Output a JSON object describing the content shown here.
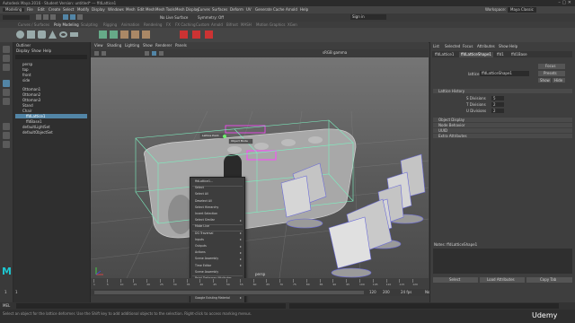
{
  "window": {
    "title": "Autodesk Maya 2016 - Student Version: untitled* --- ffdLattice1"
  },
  "menubar": {
    "mode": "Modeling",
    "items": [
      "File",
      "Edit",
      "Create",
      "Select",
      "Modify",
      "Display",
      "Windows",
      "Mesh",
      "Edit Mesh",
      "Mesh Tools",
      "Mesh Display",
      "Curves",
      "Surfaces",
      "Deform",
      "UV",
      "Generate",
      "Cache",
      "Arnold",
      "Help"
    ],
    "workspace": "Maya Classic",
    "signin": "Sign in"
  },
  "status": {
    "no_live_surface": "No Live Surface",
    "symmetry": "Symmetry: Off"
  },
  "shelf": {
    "tabs": [
      "Curves / Surfaces",
      "Poly Modeling",
      "Sculpting",
      "Rigging",
      "Animation",
      "Rendering",
      "FX",
      "FX Caching",
      "Custom",
      "Arnold",
      "Bifrost",
      "MASH",
      "Motion Graphics",
      "XGen"
    ]
  },
  "outliner": {
    "title": "Outliner",
    "menus": [
      "Display",
      "Show",
      "Help"
    ],
    "items": [
      "persp",
      "top",
      "front",
      "side",
      "Ottoman1",
      "Ottoman2",
      "Ottoman3",
      "Stand",
      "Chair",
      "ffdLattice1",
      "ffdBase1",
      "defaultLightSet",
      "defaultObjectSet"
    ],
    "selected_index": 9
  },
  "viewport": {
    "menus": [
      "View",
      "Shading",
      "Lighting",
      "Show",
      "Renderer",
      "Panels"
    ],
    "color_space": "sRGB gamma",
    "camera": "persp",
    "lattice_label": "Lattice Point",
    "object_mode_label": "Object Mode"
  },
  "context_menu": {
    "items": [
      {
        "label": "ffdLattice1...",
        "arrow": false
      },
      {
        "label": "Select",
        "arrow": false
      },
      {
        "label": "Select All",
        "arrow": false
      },
      {
        "label": "Deselect All",
        "arrow": false
      },
      {
        "label": "Select Hierarchy",
        "arrow": false
      },
      {
        "label": "Invert Selection",
        "arrow": false
      },
      {
        "label": "Select Similar",
        "arrow": true
      },
      {
        "label": "Make Live",
        "arrow": false
      },
      {
        "label": "DG Traversal",
        "arrow": true
      },
      {
        "label": "Inputs",
        "arrow": true
      },
      {
        "label": "Outputs",
        "arrow": true
      },
      {
        "label": "Actions",
        "arrow": true
      },
      {
        "label": "Scene Assembly",
        "arrow": true
      },
      {
        "label": "Time Editor",
        "arrow": true
      },
      {
        "label": "Scene Assembly",
        "arrow": false
      },
      {
        "label": "Paint Deformer Attributes...",
        "arrow": false
      },
      {
        "label": "Google Ramp Material",
        "arrow": true
      },
      {
        "label": "Google Transfer Material",
        "arrow": true
      },
      {
        "label": "Google Existing Material",
        "arrow": true
      },
      {
        "label": "Remove Material Override",
        "arrow": true
      }
    ]
  },
  "attribute_editor": {
    "menus": [
      "List",
      "Selected",
      "Focus",
      "Attributes",
      "Show",
      "Help"
    ],
    "tabs": [
      "ffdLattice1",
      "ffdLatticeShape1",
      "ffd1",
      "ffd1Base"
    ],
    "field_label": "lattice:",
    "field_value": "ffdLatticeShape1",
    "focus": "Focus",
    "presets": "Presets",
    "show_label": "Show",
    "hide_label": "Hide",
    "sections": [
      "Lattice History",
      "Object Display",
      "Node Behavior",
      "UUID",
      "Extra Attributes"
    ],
    "divisions": [
      {
        "label": "S Divisions",
        "value": "5"
      },
      {
        "label": "T Divisions",
        "value": "2"
      },
      {
        "label": "U Divisions",
        "value": "2"
      }
    ],
    "notes_label": "Notes: ffdLatticeShape1",
    "buttons": [
      "Select",
      "Load Attributes",
      "Copy Tab"
    ]
  },
  "timeline": {
    "ticks": [
      "1",
      "5",
      "10",
      "15",
      "20",
      "25",
      "30",
      "35",
      "40",
      "45",
      "50",
      "55",
      "60",
      "65",
      "70",
      "75",
      "80",
      "85",
      "90",
      "95",
      "100",
      "105",
      "110",
      "115",
      "120"
    ]
  },
  "range": {
    "start": "1",
    "start2": "1",
    "end": "120",
    "end2": "200",
    "character": "No Character Set",
    "anim_layer": "No Anim Layer",
    "fps": "24 fps"
  },
  "cmdline": {
    "lang": "MEL"
  },
  "helpline": {
    "text": "Select an object for the lattice deformer. Use the Shift key to add additional objects to the selection. Right-click to access marking menus."
  },
  "branding": {
    "udemy": "Udemy"
  },
  "colors": {
    "accent": "#5285a6",
    "lattice": "#7cf0c0",
    "highlight": "#ff44ff"
  }
}
